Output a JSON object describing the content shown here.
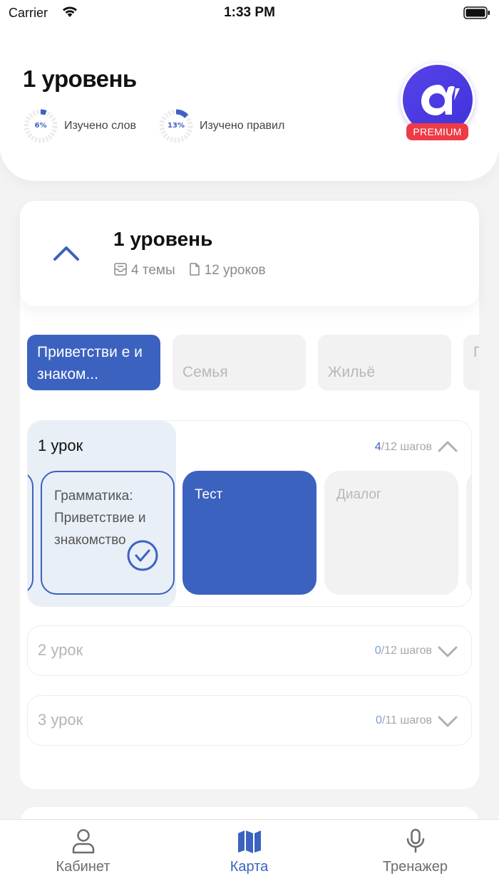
{
  "status_bar": {
    "carrier": "Carrier",
    "time": "1:33 PM"
  },
  "header": {
    "title": "1 уровень",
    "words": {
      "percent": 6,
      "label_percent": "6%",
      "text": "Изучено слов"
    },
    "rules": {
      "percent": 13,
      "label_percent": "13%",
      "text": "Изучено правил"
    },
    "premium_label": "PREMIUM"
  },
  "level": {
    "title": "1 уровень",
    "themes": "4 темы",
    "lessons": "12 уроков"
  },
  "topics": [
    {
      "label": "Приветстви е и знаком...",
      "active": true
    },
    {
      "label": "Семья",
      "active": false
    },
    {
      "label": "Жильё",
      "active": false
    },
    {
      "label": "П а",
      "active": false
    }
  ],
  "lessons": [
    {
      "title": "1 урок",
      "done": "4",
      "total": "/12 шагов",
      "expanded": true,
      "steps": [
        {
          "label": "Грамматика: Приветствие и знакомство",
          "state": "completed"
        },
        {
          "label": "Тест",
          "state": "current"
        },
        {
          "label": "Диалог",
          "state": "locked"
        }
      ]
    },
    {
      "title": "2 урок",
      "done": "0",
      "total": "/12 шагов",
      "expanded": false
    },
    {
      "title": "3 урок",
      "done": "0",
      "total": "/11 шагов",
      "expanded": false
    }
  ],
  "tabs": [
    {
      "label": "Кабинет",
      "icon": "person-icon",
      "active": false
    },
    {
      "label": "Карта",
      "icon": "map-icon",
      "active": true
    },
    {
      "label": "Тренажер",
      "icon": "microphone-icon",
      "active": false
    }
  ],
  "colors": {
    "accent": "#3c62c0",
    "premium_badge": "#ee3b45",
    "avatar": "#4a3be6"
  }
}
